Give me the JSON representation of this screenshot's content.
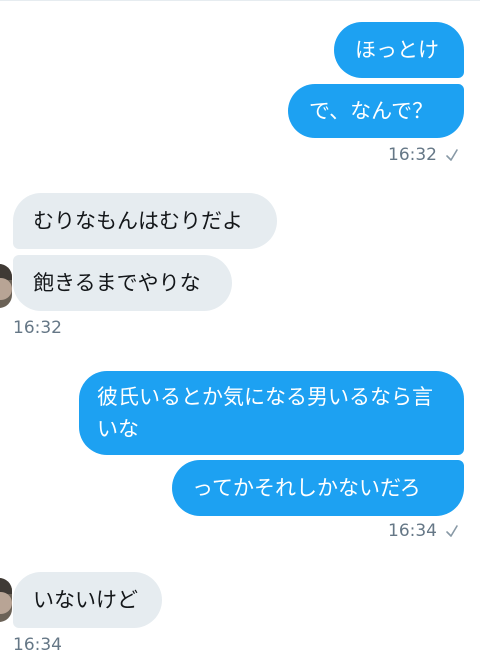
{
  "messages": {
    "m1": {
      "text": "ほっとけ"
    },
    "m2": {
      "text": "で、なんで？"
    },
    "m2_time": "16:32",
    "m3": {
      "text": "むりなもんはむりだよ"
    },
    "m4": {
      "text": "飽きるまでやりな"
    },
    "m4_time": "16:32",
    "m5": {
      "text": "彼氏いるとか気になる男いるなら言いな"
    },
    "m6": {
      "text": "ってかそれしかないだろ"
    },
    "m6_time": "16:34",
    "m7": {
      "text": "いないけど"
    },
    "m7_time": "16:34"
  },
  "colors": {
    "sent_bubble": "#1da1f2",
    "received_bubble": "#e6ecf0",
    "timestamp": "#657786"
  },
  "icons": {
    "read_receipt": "check-icon",
    "avatar": "avatar"
  }
}
